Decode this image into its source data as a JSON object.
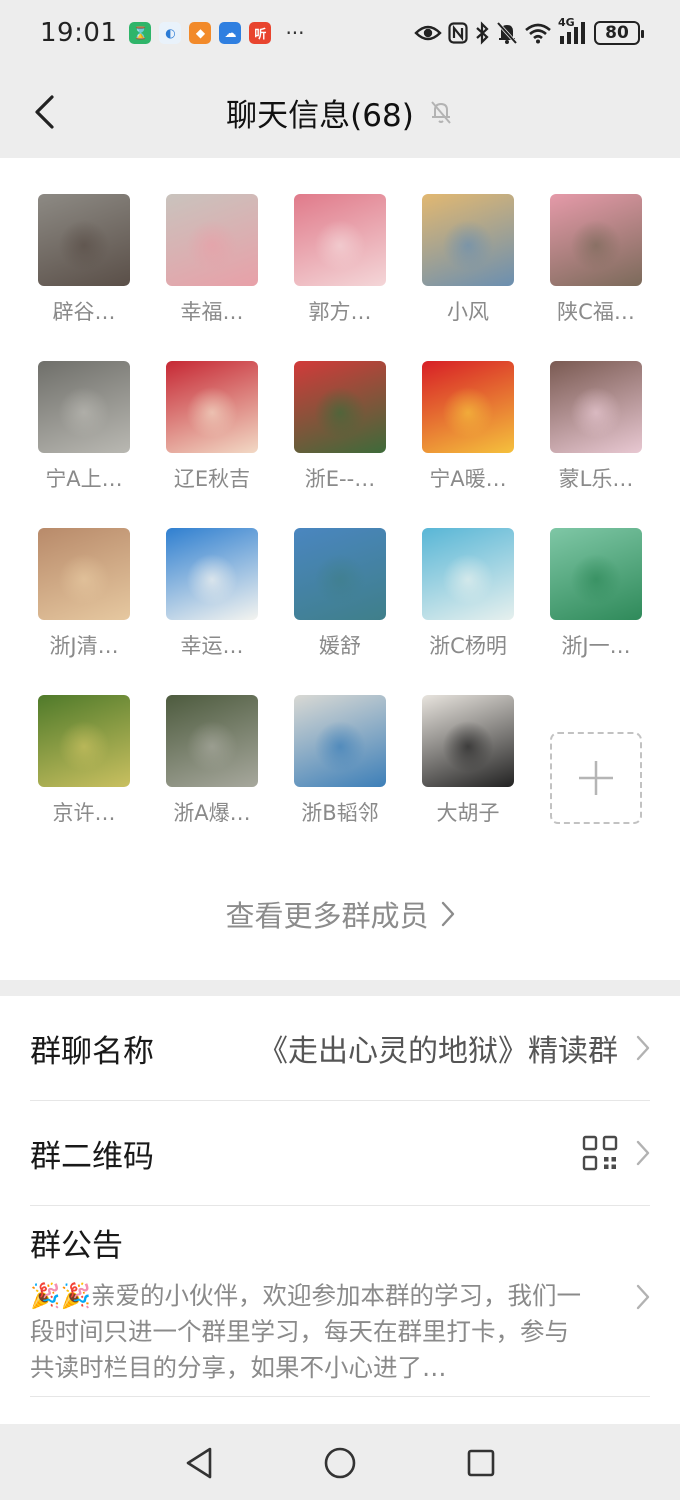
{
  "status_bar": {
    "time": "19:01",
    "more": "···",
    "network": "4G",
    "battery": "80"
  },
  "header": {
    "title": "聊天信息(68)"
  },
  "members": [
    {
      "name": "辟谷…",
      "colors": [
        "#8d8a84",
        "#5a4f48"
      ]
    },
    {
      "name": "幸福…",
      "colors": [
        "#c9c3bd",
        "#e8a0a8"
      ]
    },
    {
      "name": "郭方…",
      "colors": [
        "#e07a8a",
        "#f4d6d8"
      ]
    },
    {
      "name": "小风",
      "colors": [
        "#e2b871",
        "#6b8fb0"
      ]
    },
    {
      "name": "陕C福…",
      "colors": [
        "#e59aa9",
        "#7b6a5a"
      ]
    },
    {
      "name": "宁A上…",
      "colors": [
        "#6f6f6a",
        "#b9b8b2"
      ]
    },
    {
      "name": "辽E秋吉",
      "colors": [
        "#c62834",
        "#f2d9c5"
      ]
    },
    {
      "name": "浙E--…",
      "colors": [
        "#d23a3a",
        "#3d6b3a"
      ]
    },
    {
      "name": "宁A暖…",
      "colors": [
        "#d71f26",
        "#f5c13d"
      ]
    },
    {
      "name": "蒙L乐…",
      "colors": [
        "#7a5a52",
        "#e8c8d2"
      ]
    },
    {
      "name": "浙J清…",
      "colors": [
        "#b88a6a",
        "#e6c8a0"
      ]
    },
    {
      "name": "幸运…",
      "colors": [
        "#2f7fd0",
        "#f4f4f0"
      ]
    },
    {
      "name": "媛舒",
      "colors": [
        "#4a86c0",
        "#3f7f8a"
      ]
    },
    {
      "name": "浙C杨明",
      "colors": [
        "#58b6d6",
        "#e6f0ee"
      ]
    },
    {
      "name": "浙J一…",
      "colors": [
        "#7fc7a6",
        "#2f8a5a"
      ]
    },
    {
      "name": "京许…",
      "colors": [
        "#4f7a2a",
        "#c9c060"
      ]
    },
    {
      "name": "浙A爆…",
      "colors": [
        "#4d5b3e",
        "#a7a89d"
      ]
    },
    {
      "name": "浙B韬邻",
      "colors": [
        "#d9d9d4",
        "#3d7fb8"
      ]
    },
    {
      "name": "大胡子",
      "colors": [
        "#e8e4de",
        "#222222"
      ]
    }
  ],
  "see_more": "查看更多群成员",
  "settings": {
    "group_name_label": "群聊名称",
    "group_name_value": "《走出心灵的地狱》精读群",
    "qr_label": "群二维码",
    "notice_label": "群公告",
    "notice_emoji": "🎉🎉",
    "notice_text": "亲爱的小伙伴，欢迎参加本群的学习，我们一段时间只进一个群里学习，每天在群里打卡，参与共读时栏目的分享，如果不小心进了…"
  },
  "colors": {
    "background": "#ededed",
    "card": "#ffffff",
    "secondary_text": "#8a8a8a"
  }
}
